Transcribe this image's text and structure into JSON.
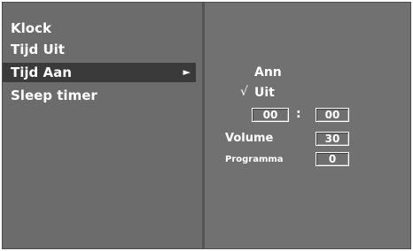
{
  "menu": {
    "items": [
      {
        "label": "Klock"
      },
      {
        "label": "Tijd Uit"
      },
      {
        "label": "Tijd Aan"
      },
      {
        "label": "Sleep timer"
      }
    ],
    "active_arrow": "►"
  },
  "submenu": {
    "option_on": "Ann",
    "option_off": "Uit",
    "checkmark": "√",
    "hours": "00",
    "separator": ":",
    "minutes": "00",
    "volume_label": "Volume",
    "volume_value": "30",
    "program_label": "Programma",
    "program_value": "0"
  },
  "colors": {
    "panel": "#6c6c6c",
    "highlight": "#3a3a3a",
    "text": "#ffffff"
  }
}
